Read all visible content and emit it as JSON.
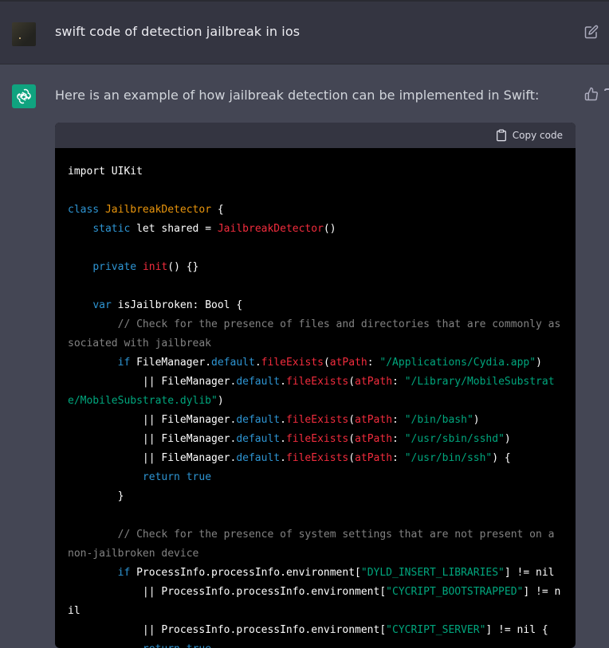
{
  "user": {
    "message": "swift code of detection jailbreak in ios"
  },
  "assistant": {
    "intro": "Here is an example of how jailbreak detection can be implemented in Swift:"
  },
  "code_block": {
    "copy_label": "Copy code",
    "lines": [
      [
        {
          "t": "pl",
          "v": "import UIKit"
        }
      ],
      [],
      [
        {
          "t": "kw",
          "v": "class"
        },
        {
          "t": "pl",
          "v": " "
        },
        {
          "t": "cls",
          "v": "JailbreakDetector"
        },
        {
          "t": "pl",
          "v": " {"
        }
      ],
      [
        {
          "t": "pl",
          "v": "    "
        },
        {
          "t": "kw",
          "v": "static"
        },
        {
          "t": "pl",
          "v": " let shared = "
        },
        {
          "t": "ty",
          "v": "JailbreakDetector"
        },
        {
          "t": "pl",
          "v": "()"
        }
      ],
      [],
      [
        {
          "t": "pl",
          "v": "    "
        },
        {
          "t": "kw",
          "v": "private"
        },
        {
          "t": "pl",
          "v": " "
        },
        {
          "t": "ty",
          "v": "init"
        },
        {
          "t": "pl",
          "v": "() {}"
        }
      ],
      [],
      [
        {
          "t": "pl",
          "v": "    "
        },
        {
          "t": "kw",
          "v": "var"
        },
        {
          "t": "pl",
          "v": " isJailbroken: Bool {"
        }
      ],
      [
        {
          "t": "cm",
          "v": "        // Check for the presence of files and directories that are commonly associated with jailbreak"
        }
      ],
      [
        {
          "t": "pl",
          "v": "        "
        },
        {
          "t": "kw",
          "v": "if"
        },
        {
          "t": "pl",
          "v": " FileManager."
        },
        {
          "t": "kw",
          "v": "default"
        },
        {
          "t": "pl",
          "v": "."
        },
        {
          "t": "ty",
          "v": "fileExists"
        },
        {
          "t": "pl",
          "v": "("
        },
        {
          "t": "ty",
          "v": "atPath"
        },
        {
          "t": "pl",
          "v": ": "
        },
        {
          "t": "str",
          "v": "\"/Applications/Cydia.app\""
        },
        {
          "t": "pl",
          "v": ")"
        }
      ],
      [
        {
          "t": "pl",
          "v": "            || FileManager."
        },
        {
          "t": "kw",
          "v": "default"
        },
        {
          "t": "pl",
          "v": "."
        },
        {
          "t": "ty",
          "v": "fileExists"
        },
        {
          "t": "pl",
          "v": "("
        },
        {
          "t": "ty",
          "v": "atPath"
        },
        {
          "t": "pl",
          "v": ": "
        },
        {
          "t": "str",
          "v": "\"/Library/MobileSubstrate/MobileSubstrate.dylib\""
        },
        {
          "t": "pl",
          "v": ")"
        }
      ],
      [
        {
          "t": "pl",
          "v": "            || FileManager."
        },
        {
          "t": "kw",
          "v": "default"
        },
        {
          "t": "pl",
          "v": "."
        },
        {
          "t": "ty",
          "v": "fileExists"
        },
        {
          "t": "pl",
          "v": "("
        },
        {
          "t": "ty",
          "v": "atPath"
        },
        {
          "t": "pl",
          "v": ": "
        },
        {
          "t": "str",
          "v": "\"/bin/bash\""
        },
        {
          "t": "pl",
          "v": ")"
        }
      ],
      [
        {
          "t": "pl",
          "v": "            || FileManager."
        },
        {
          "t": "kw",
          "v": "default"
        },
        {
          "t": "pl",
          "v": "."
        },
        {
          "t": "ty",
          "v": "fileExists"
        },
        {
          "t": "pl",
          "v": "("
        },
        {
          "t": "ty",
          "v": "atPath"
        },
        {
          "t": "pl",
          "v": ": "
        },
        {
          "t": "str",
          "v": "\"/usr/sbin/sshd\""
        },
        {
          "t": "pl",
          "v": ")"
        }
      ],
      [
        {
          "t": "pl",
          "v": "            || FileManager."
        },
        {
          "t": "kw",
          "v": "default"
        },
        {
          "t": "pl",
          "v": "."
        },
        {
          "t": "ty",
          "v": "fileExists"
        },
        {
          "t": "pl",
          "v": "("
        },
        {
          "t": "ty",
          "v": "atPath"
        },
        {
          "t": "pl",
          "v": ": "
        },
        {
          "t": "str",
          "v": "\"/usr/bin/ssh\""
        },
        {
          "t": "pl",
          "v": ") {"
        }
      ],
      [
        {
          "t": "pl",
          "v": "            "
        },
        {
          "t": "kw",
          "v": "return"
        },
        {
          "t": "pl",
          "v": " "
        },
        {
          "t": "kw",
          "v": "true"
        }
      ],
      [
        {
          "t": "pl",
          "v": "        }"
        }
      ],
      [],
      [
        {
          "t": "cm",
          "v": "        // Check for the presence of system settings that are not present on a non-jailbroken device"
        }
      ],
      [
        {
          "t": "pl",
          "v": "        "
        },
        {
          "t": "kw",
          "v": "if"
        },
        {
          "t": "pl",
          "v": " ProcessInfo.processInfo.environment["
        },
        {
          "t": "str",
          "v": "\"DYLD_INSERT_LIBRARIES\""
        },
        {
          "t": "pl",
          "v": "] != nil"
        }
      ],
      [
        {
          "t": "pl",
          "v": "            || ProcessInfo.processInfo.environment["
        },
        {
          "t": "str",
          "v": "\"CYCRIPT_BOOTSTRAPPED\""
        },
        {
          "t": "pl",
          "v": "] != nil"
        }
      ],
      [
        {
          "t": "pl",
          "v": "            || ProcessInfo.processInfo.environment["
        },
        {
          "t": "str",
          "v": "\"CYCRIPT_SERVER\""
        },
        {
          "t": "pl",
          "v": "] != nil {"
        }
      ],
      [
        {
          "t": "pl",
          "v": "            "
        },
        {
          "t": "kw",
          "v": "return"
        },
        {
          "t": "pl",
          "v": " "
        },
        {
          "t": "kw",
          "v": "true"
        }
      ]
    ]
  },
  "colors": {
    "user_bg": "#343541",
    "assistant_bg": "#444654",
    "code_bg": "#000000",
    "code_header_bg": "#343541",
    "brand": "#10a37f",
    "keyword": "#2e95d3",
    "type": "#f22c3d",
    "class": "#e9950c",
    "string": "#00a67d"
  },
  "icons": {
    "edit": "pencil-square-icon",
    "thumb": "thumbs-up-icon",
    "copy": "clipboard-icon",
    "assistant_avatar": "openai-logo-icon"
  }
}
